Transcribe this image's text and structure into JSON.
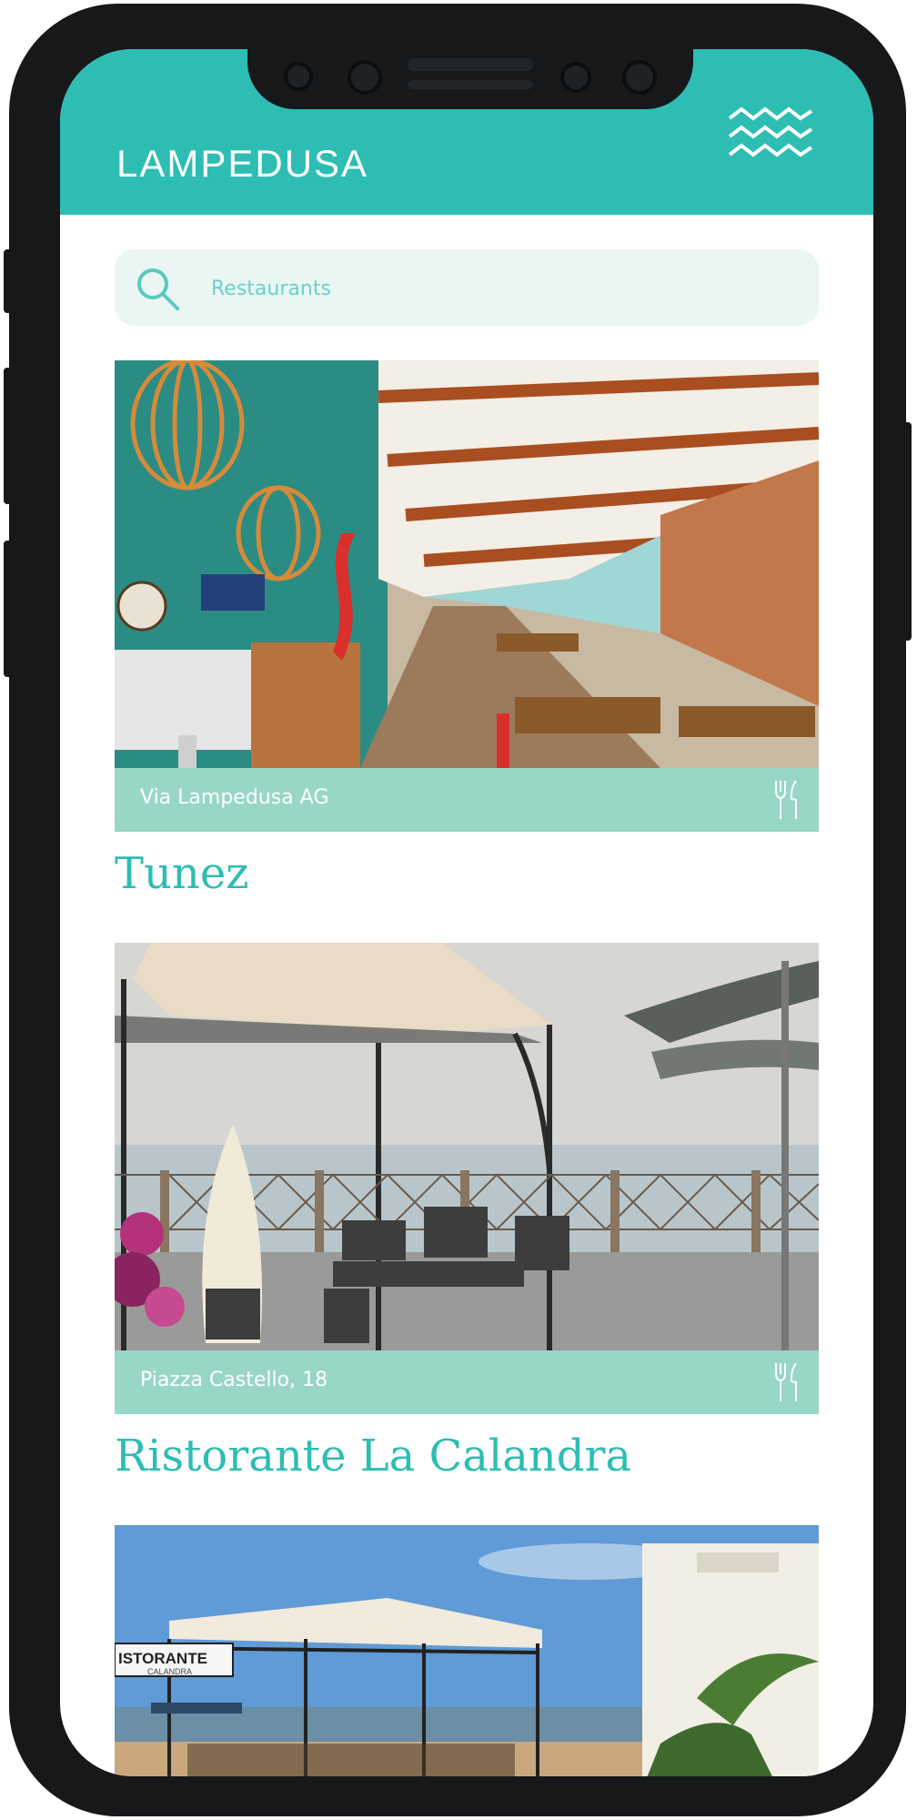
{
  "header": {
    "logo": "LAMPEDUSA",
    "menu_icon": "waves-menu-icon"
  },
  "search": {
    "placeholder": "Restaurants",
    "icon": "search-icon"
  },
  "restaurants": [
    {
      "address": "Via Lampedusa AG",
      "name": "Tunez",
      "icon": "fork-knife-icon"
    },
    {
      "address": "Piazza Castello, 18",
      "name": "Ristorante La Calandra",
      "icon": "fork-knife-icon"
    },
    {
      "sign_text": "ISTORANTE",
      "sign_subtext": "CALANDRA"
    }
  ],
  "colors": {
    "accent": "#2dbdb3",
    "address_bar": "#98d6c8",
    "search_bg": "#eaf6f4",
    "phone": "#16181a"
  }
}
